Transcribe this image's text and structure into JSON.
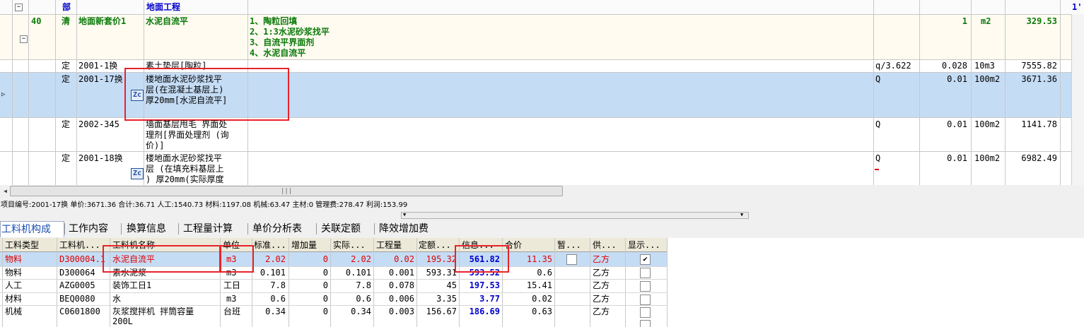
{
  "header_row": {
    "dept_label": "部",
    "category": "地面工程",
    "col_marker": "1'"
  },
  "main_item": {
    "index": "40",
    "type": "清",
    "code": "地面新套价1",
    "name": "水泥自流平",
    "features": [
      "1、陶粒回填",
      "2、1:3水泥砂浆找平",
      "3、自流平界面剂",
      "4、水泥自流平"
    ],
    "qty": "1",
    "unit": "m2",
    "price": "329.53"
  },
  "sub_items": [
    {
      "type": "定",
      "code": "2001-1换",
      "name_lines": [
        "素土垫层[陶粒]"
      ],
      "qty_expr": "q/3.622",
      "qty": "0.028",
      "unit": "10m3",
      "price": "7555.82"
    },
    {
      "type": "定",
      "code": "2001-17换",
      "name_lines": [
        "楼地面水泥砂浆找平",
        "层(在混凝土基层上)",
        "厚20mm[水泥自流平]"
      ],
      "qty_expr": "Q",
      "qty": "0.01",
      "unit": "100m2",
      "price": "3671.36"
    },
    {
      "type": "定",
      "code": "2002-345",
      "name_lines": [
        "墙面基层甩毛 界面处",
        "理剂[界面处理剂 (询",
        "价)]"
      ],
      "qty_expr": "Q",
      "qty": "0.01",
      "unit": "100m2",
      "price": "1141.78"
    },
    {
      "type": "定",
      "code": "2001-18换",
      "name_lines": [
        "楼地面水泥砂浆找平",
        "层 (在填充料基层上",
        ") 厚20mm(实际厚度"
      ],
      "qty_expr": "Q",
      "qty": "0.01",
      "unit": "100m2",
      "price": "6982.49"
    }
  ],
  "zc_icon_text": "Zc",
  "status_bar": "项目编号:2001-17换  单价:3671.36  合计:36.71  人工:1540.73  材料:1197.08  机械:63.47  主材:0  管理费:278.47  利润:153.99",
  "tabs": [
    "工料机构成",
    "工作内容",
    "换算信息",
    "工程量计算",
    "单价分析表",
    "关联定额",
    "降效增加费"
  ],
  "resource_headers": [
    "工料类型",
    "工料机...",
    "工料机名称",
    "单位",
    "标准...",
    "增加量",
    "实际...",
    "工程量",
    "定额...",
    "信息...",
    "合价",
    "暂...",
    "供...",
    "显示..."
  ],
  "resources": [
    {
      "type": "物料",
      "code": "D300004.1",
      "name": "水泥自流平",
      "unit": "m3",
      "std": "2.02",
      "add": "0",
      "actual": "2.02",
      "qty": "0.02",
      "quota": "195.32",
      "info": "561.82",
      "total": "11.35",
      "supply": "乙方",
      "checked": "✔"
    },
    {
      "type": "物料",
      "code": "D300064",
      "name": "素水泥浆",
      "unit": "m3",
      "std": "0.101",
      "add": "0",
      "actual": "0.101",
      "qty": "0.001",
      "quota": "593.31",
      "info": "593.52",
      "total": "0.6",
      "supply": "乙方",
      "checked": ""
    },
    {
      "type": "人工",
      "code": "AZG0005",
      "name": "装饰工日1",
      "unit": "工日",
      "std": "7.8",
      "add": "0",
      "actual": "7.8",
      "qty": "0.078",
      "quota": "45",
      "info": "197.53",
      "total": "15.41",
      "supply": "乙方",
      "checked": ""
    },
    {
      "type": "材料",
      "code": "BEQ0080",
      "name": "水",
      "unit": "m3",
      "std": "0.6",
      "add": "0",
      "actual": "0.6",
      "qty": "0.006",
      "quota": "3.35",
      "info": "3.77",
      "total": "0.02",
      "supply": "乙方",
      "checked": ""
    },
    {
      "type": "机械",
      "code": "C0601800",
      "name": "灰浆搅拌机 拌筒容量",
      "name2": "200L",
      "unit": "台班",
      "std": "0.34",
      "add": "0",
      "actual": "0.34",
      "qty": "0.003",
      "quota": "156.67",
      "info": "186.69",
      "total": "0.63",
      "supply": "乙方",
      "checked": ""
    }
  ],
  "colors": {
    "highlight_row": "#c5dcf5",
    "main_row": "#fffbf0",
    "annotation": "#e8232a",
    "info_value": "#0000cc",
    "changed_value": "#e00000"
  }
}
